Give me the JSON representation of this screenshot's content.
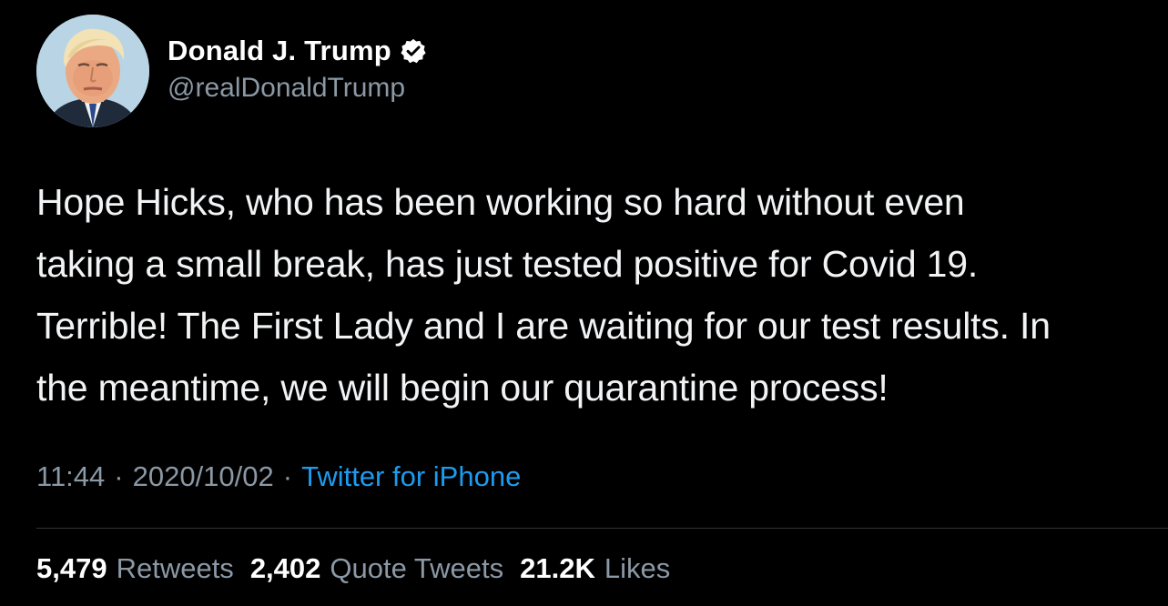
{
  "colors": {
    "background": "#000000",
    "primary_text": "#ffffff",
    "secondary_text": "#8b98a5",
    "link": "#1d9bf0",
    "verified_badge": "#ffffff",
    "divider": "#2f3336"
  },
  "author": {
    "display_name": "Donald J. Trump",
    "handle": "@realDonaldTrump",
    "verified": true,
    "avatar_icon": "profile-photo"
  },
  "tweet": {
    "lines": [
      "Hope Hicks, who has been working so hard without even",
      "taking a small break, has just tested positive for Covid 19.",
      "Terrible! The First Lady and I are waiting for our test results. In",
      "the meantime, we will begin our quarantine process!"
    ]
  },
  "meta": {
    "time": "11:44",
    "separator": "·",
    "date": "2020/10/02",
    "source": "Twitter for iPhone"
  },
  "stats": {
    "retweets_count": "5,479",
    "retweets_label": "Retweets",
    "quotes_count": "2,402",
    "quotes_label": "Quote Tweets",
    "likes_count": "21.2K",
    "likes_label": "Likes"
  }
}
